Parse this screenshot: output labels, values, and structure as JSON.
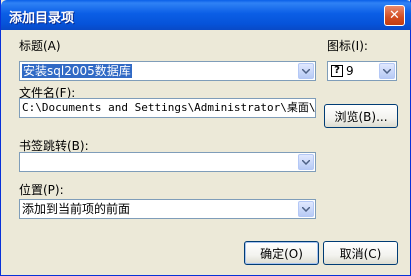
{
  "dialog": {
    "title": "添加目录项",
    "close_symbol": "✕"
  },
  "title_field": {
    "label": "标题(A)",
    "value": "安装sql2005数据库"
  },
  "icon_field": {
    "label": "图标(I):",
    "value": "9"
  },
  "file_field": {
    "label": "文件名(F):",
    "value": "C:\\Documents and Settings\\Administrator\\桌面\\使用"
  },
  "bookmark_field": {
    "label": "书签跳转(B):",
    "value": ""
  },
  "position_field": {
    "label": "位置(P):",
    "value": "添加到当前项的前面"
  },
  "buttons": {
    "browse": "浏览(B)...",
    "ok": "确定(O)",
    "cancel": "取消(C)"
  },
  "icons": {
    "dropdown": "chevron-down-icon",
    "icon_preview": "question-mark-icon",
    "close": "close-icon"
  }
}
